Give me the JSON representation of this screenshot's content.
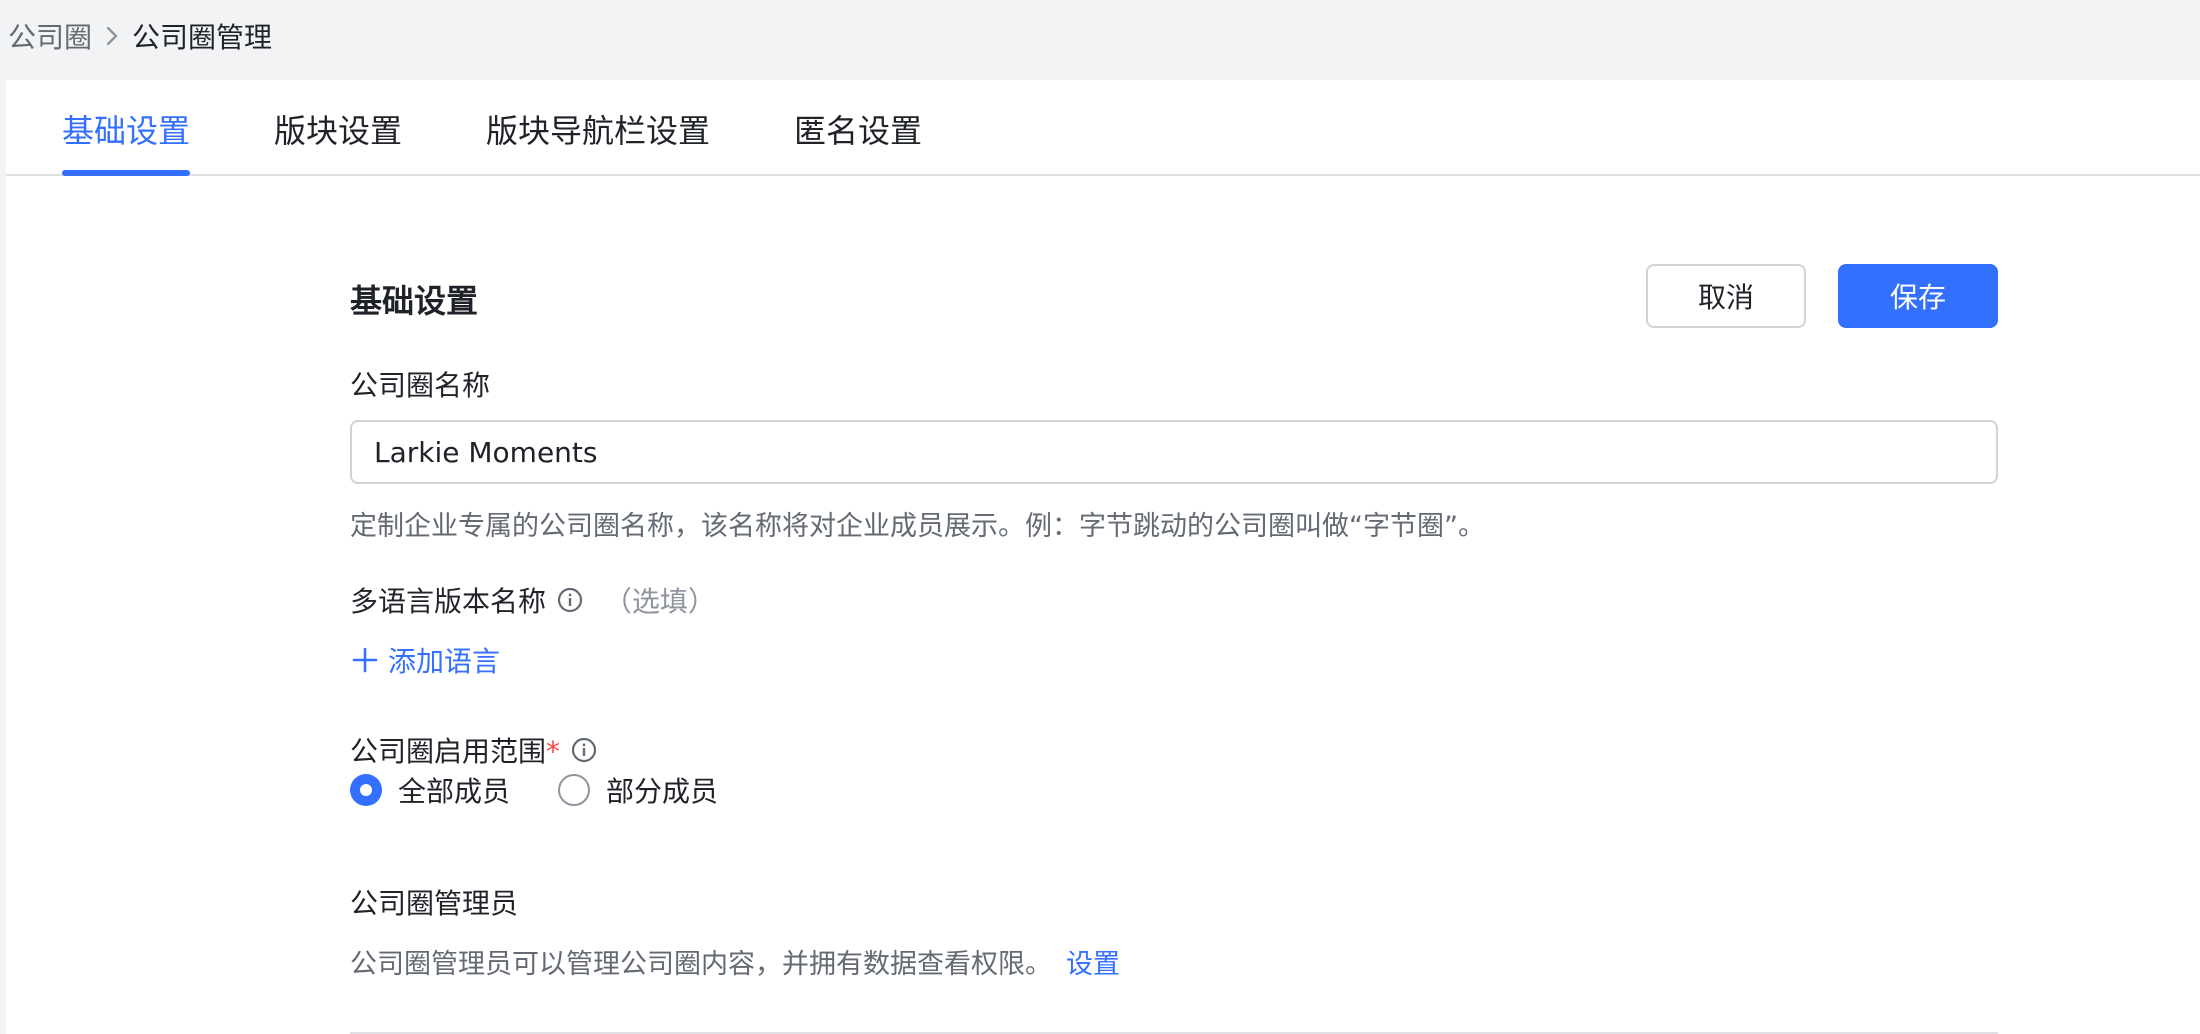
{
  "breadcrumb": {
    "parent": "公司圈",
    "current": "公司圈管理"
  },
  "tabs": [
    {
      "label": "基础设置",
      "active": true
    },
    {
      "label": "版块设置",
      "active": false
    },
    {
      "label": "版块导航栏设置",
      "active": false
    },
    {
      "label": "匿名设置",
      "active": false
    }
  ],
  "section": {
    "title": "基础设置",
    "cancel_label": "取消",
    "save_label": "保存"
  },
  "name_field": {
    "label": "公司圈名称",
    "value": "Larkie Moments",
    "hint": "定制企业专属的公司圈名称，该名称将对企业成员展示。例：字节跳动的公司圈叫做“字节圈”。"
  },
  "multilang": {
    "label": "多语言版本名称",
    "optional": "（选填）",
    "add_label": "添加语言"
  },
  "scope": {
    "label": "公司圈启用范围",
    "required_mark": "*",
    "options": [
      {
        "label": "全部成员",
        "selected": true
      },
      {
        "label": "部分成员",
        "selected": false
      }
    ]
  },
  "admins": {
    "label": "公司圈管理员",
    "hint": "公司圈管理员可以管理公司圈内容，并拥有数据查看权限。",
    "link": "设置"
  },
  "colors": {
    "accent": "#3370ff",
    "required": "#f54a45"
  }
}
